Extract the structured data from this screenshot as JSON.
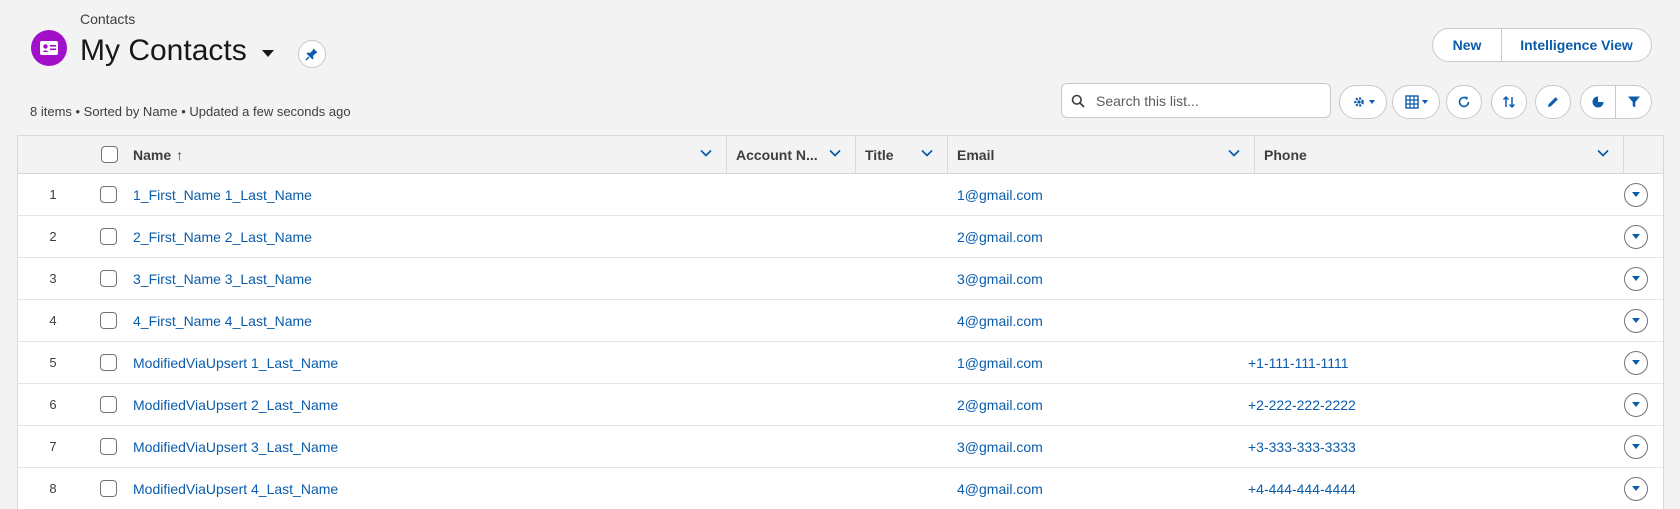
{
  "header": {
    "breadcrumb": "Contacts",
    "title": "My Contacts",
    "subtitle": "8 items • Sorted by Name • Updated a few seconds ago",
    "buttons": {
      "new": "New",
      "intelligence_view": "Intelligence View"
    }
  },
  "search": {
    "placeholder": "Search this list..."
  },
  "toolbar": [
    {
      "icon": "gear-icon"
    },
    {
      "icon": "table-display-icon"
    },
    {
      "icon": "refresh-icon"
    },
    {
      "icon": "sort-icon"
    },
    {
      "icon": "edit-icon"
    },
    {
      "icon": "chart-icon"
    },
    {
      "icon": "filter-icon"
    }
  ],
  "table": {
    "columns": {
      "name": "Name",
      "name_sort": "↑",
      "account": "Account N...",
      "title": "Title",
      "email": "Email",
      "phone": "Phone"
    },
    "rows": [
      {
        "num": "1",
        "name": "1_First_Name 1_Last_Name",
        "account": "",
        "title": "",
        "email": "1@gmail.com",
        "phone": ""
      },
      {
        "num": "2",
        "name": "2_First_Name 2_Last_Name",
        "account": "",
        "title": "",
        "email": "2@gmail.com",
        "phone": ""
      },
      {
        "num": "3",
        "name": "3_First_Name 3_Last_Name",
        "account": "",
        "title": "",
        "email": "3@gmail.com",
        "phone": ""
      },
      {
        "num": "4",
        "name": "4_First_Name 4_Last_Name",
        "account": "",
        "title": "",
        "email": "4@gmail.com",
        "phone": ""
      },
      {
        "num": "5",
        "name": "ModifiedViaUpsert 1_Last_Name",
        "account": "",
        "title": "",
        "email": "1@gmail.com",
        "phone": "+1-111-111-1111"
      },
      {
        "num": "6",
        "name": "ModifiedViaUpsert 2_Last_Name",
        "account": "",
        "title": "",
        "email": "2@gmail.com",
        "phone": "+2-222-222-2222"
      },
      {
        "num": "7",
        "name": "ModifiedViaUpsert 3_Last_Name",
        "account": "",
        "title": "",
        "email": "3@gmail.com",
        "phone": "+3-333-333-3333"
      },
      {
        "num": "8",
        "name": "ModifiedViaUpsert 4_Last_Name",
        "account": "",
        "title": "",
        "email": "4@gmail.com",
        "phone": "+4-444-444-4444"
      }
    ]
  },
  "colors": {
    "accent": "#0b5cab",
    "app_icon": "#a10fc9"
  }
}
